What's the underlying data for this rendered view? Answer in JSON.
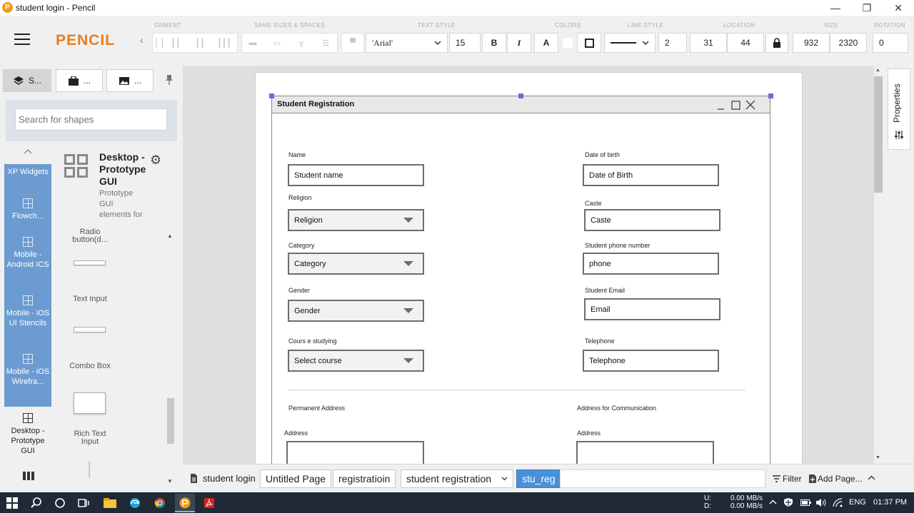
{
  "window": {
    "title": "student login - Pencil",
    "logo_letter": "P",
    "minimize": "—",
    "restore": "❐",
    "close": "✕"
  },
  "toolbar": {
    "app_name": "PENCIL",
    "collapse": "‹",
    "sections": {
      "alignment": "GNMENT",
      "same_sizes": "SAME SIZES & SPACES",
      "text_style": "TEXT STYLE",
      "colors": "COLORS",
      "line_style": "LINE STYLE",
      "location": "LOCATION",
      "size": "SIZE",
      "rotation": "ROTATION"
    },
    "font_family": "'Arial'",
    "font_size": "15",
    "bold": "B",
    "italic": "I",
    "text_color": "A",
    "line_width": "2",
    "x": "31",
    "y": "44",
    "width": "932",
    "height": "2320",
    "rotation": "0",
    "fill_color": "#ffffff",
    "stroke_color": "#222222"
  },
  "left_panel": {
    "tabs": [
      {
        "label": "S...",
        "icon": "layers-icon"
      },
      {
        "label": "...",
        "icon": "briefcase-icon"
      },
      {
        "label": "...",
        "icon": "image-icon"
      }
    ],
    "pin": "📌",
    "search_placeholder": "Search for shapes",
    "collections": [
      {
        "label": "XP Widgets"
      },
      {
        "label": "Flowch..."
      },
      {
        "label": "Mobile - Android ICS"
      },
      {
        "label": "Mobile - iOS UI Stencils"
      },
      {
        "label": "Mobile - iOS Wirefra..."
      },
      {
        "label": "Desktop - Prototype GUI"
      }
    ],
    "selected_collection": {
      "title": "Desktop - Prototype GUI",
      "description": "Prototype GUI elements for"
    },
    "shapes": [
      "Radio button(d...",
      "Text Input",
      "Combo Box",
      "Rich Text Input"
    ],
    "collection_accent": "#6b9bd1"
  },
  "dialog": {
    "title": "Student Registration",
    "left_fields": [
      {
        "label": "Name",
        "value": "Student name",
        "kind": "text"
      },
      {
        "label": "Religion",
        "value": "Religion",
        "kind": "combo"
      },
      {
        "label": "Category",
        "value": "Category",
        "kind": "combo"
      },
      {
        "label": "Gender",
        "value": "Gender",
        "kind": "combo"
      },
      {
        "label": "Cours e studying",
        "value": "Select course",
        "kind": "combo"
      }
    ],
    "right_fields": [
      {
        "label": "Date of birth",
        "value": "Date of Birth"
      },
      {
        "label": "Caste",
        "value": "Caste"
      },
      {
        "label": "Student phone number",
        "value": "phone"
      },
      {
        "label": "Student Email",
        "value": "Email"
      },
      {
        "label": "Telephone",
        "value": "Telephone"
      }
    ],
    "permanent_address": "Permanent Address",
    "communication_address": "Address for Communication",
    "address_label": "Address"
  },
  "right_panel": {
    "properties": "Properties"
  },
  "page_tabs": {
    "current": "student login",
    "tabs": [
      "Untitled Page",
      "registratioin",
      "student registration",
      "stu_reg"
    ],
    "filter": "Filter",
    "add_page": "Add Page...",
    "active_color": "#4a90d9"
  },
  "taskbar": {
    "net_up_label": "U:",
    "net_down_label": "D:",
    "net_up": "0.00 MB/s",
    "net_down": "0.00 MB/s",
    "language": "ENG",
    "time": "01:37 PM"
  }
}
